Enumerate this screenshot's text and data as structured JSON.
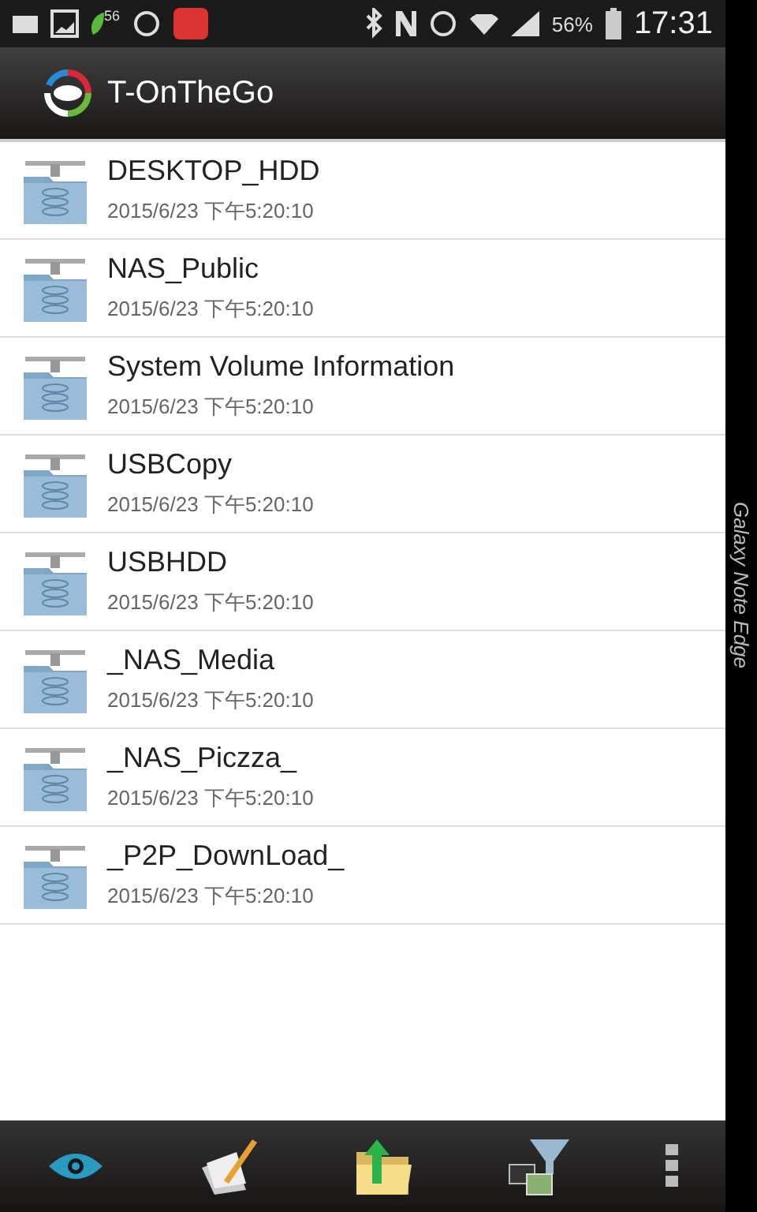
{
  "status_bar": {
    "notification_badge": "56",
    "battery": "56%",
    "time": "17:31"
  },
  "app_bar": {
    "title": "T-OnTheGo"
  },
  "folders": [
    {
      "name": "DESKTOP_HDD",
      "modified": "2015/6/23 下午5:20:10"
    },
    {
      "name": "NAS_Public",
      "modified": "2015/6/23 下午5:20:10"
    },
    {
      "name": "System Volume Information",
      "modified": "2015/6/23 下午5:20:10"
    },
    {
      "name": "USBCopy",
      "modified": "2015/6/23 下午5:20:10"
    },
    {
      "name": "USBHDD",
      "modified": "2015/6/23 下午5:20:10"
    },
    {
      "name": "_NAS_Media",
      "modified": "2015/6/23 下午5:20:10"
    },
    {
      "name": "_NAS_Piczza_",
      "modified": "2015/6/23 下午5:20:10"
    },
    {
      "name": "_P2P_DownLoad_",
      "modified": "2015/6/23 下午5:20:10"
    }
  ],
  "toolbar": [
    {
      "kind": "view"
    },
    {
      "kind": "edit"
    },
    {
      "kind": "upload"
    },
    {
      "kind": "filter"
    },
    {
      "kind": "more"
    }
  ],
  "edge_panel": {
    "label": "Galaxy Note Edge"
  }
}
